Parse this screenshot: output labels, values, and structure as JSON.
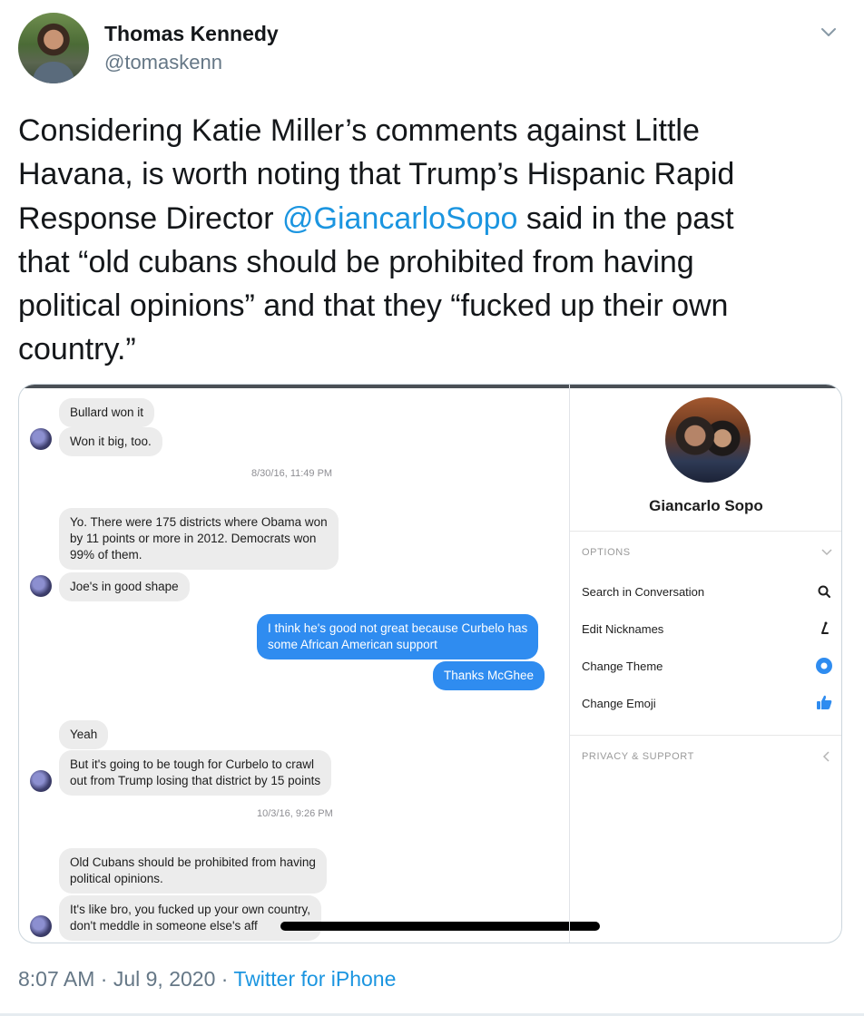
{
  "author": {
    "name": "Thomas Kennedy",
    "handle": "@tomaskenn"
  },
  "tweet": {
    "lines": [
      "Considering Katie Miller’s comments against Little",
      "Havana, is worth noting that Trump’s Hispanic Rapid",
      [
        "Response Director ",
        "@GiancarloSopo",
        " said in the past"
      ],
      "that “old cubans should be prohibited from having",
      "political opinions” and that they “fucked up their own",
      "country.”"
    ]
  },
  "screenshot": {
    "messages": [
      {
        "text": "Bullard won it"
      },
      {
        "text": "Won it big, too."
      },
      {
        "timestamp": "8/30/16, 11:49 PM"
      },
      {
        "text": [
          "Yo. There were 175 districts where Obama won",
          "by 11 points or more in 2012. Democrats won",
          "99% of them."
        ]
      },
      {
        "text": "Joe's in good shape"
      },
      {
        "text": [
          "I think he's good not great because Curbelo has",
          "some African American support"
        ]
      },
      {
        "text": "Thanks McGhee"
      },
      {
        "text": "Yeah"
      },
      {
        "text": [
          "But it's going to be tough for Curbelo to crawl",
          "out from Trump losing that district by 15 points"
        ]
      },
      {
        "timestamp": "10/3/16, 9:26 PM"
      },
      {
        "text": [
          "Old Cubans should be prohibited from having",
          "political opinions."
        ]
      },
      {
        "text": [
          "It's like bro, you fucked up your own country,",
          "don't meddle in someone else's aff"
        ]
      }
    ],
    "panel": {
      "contact_name": "Giancarlo Sopo",
      "options_header": "OPTIONS",
      "items": [
        {
          "label": "Search in Conversation",
          "icon": "search-icon"
        },
        {
          "label": "Edit Nicknames",
          "icon": "pencil-icon"
        },
        {
          "label": "Change Theme",
          "icon": "theme-icon"
        },
        {
          "label": "Change Emoji",
          "icon": "thumbs-up-icon"
        }
      ],
      "privacy_header": "PRIVACY & SUPPORT"
    }
  },
  "meta": {
    "time": "8:07 AM",
    "sep1": " · ",
    "date": "Jul 9, 2020",
    "sep2": " · ",
    "source": "Twitter for iPhone"
  },
  "colors": {
    "link": "#1b95e0",
    "messenger_blue": "#2f8cf0",
    "secondary_text": "#657786"
  }
}
